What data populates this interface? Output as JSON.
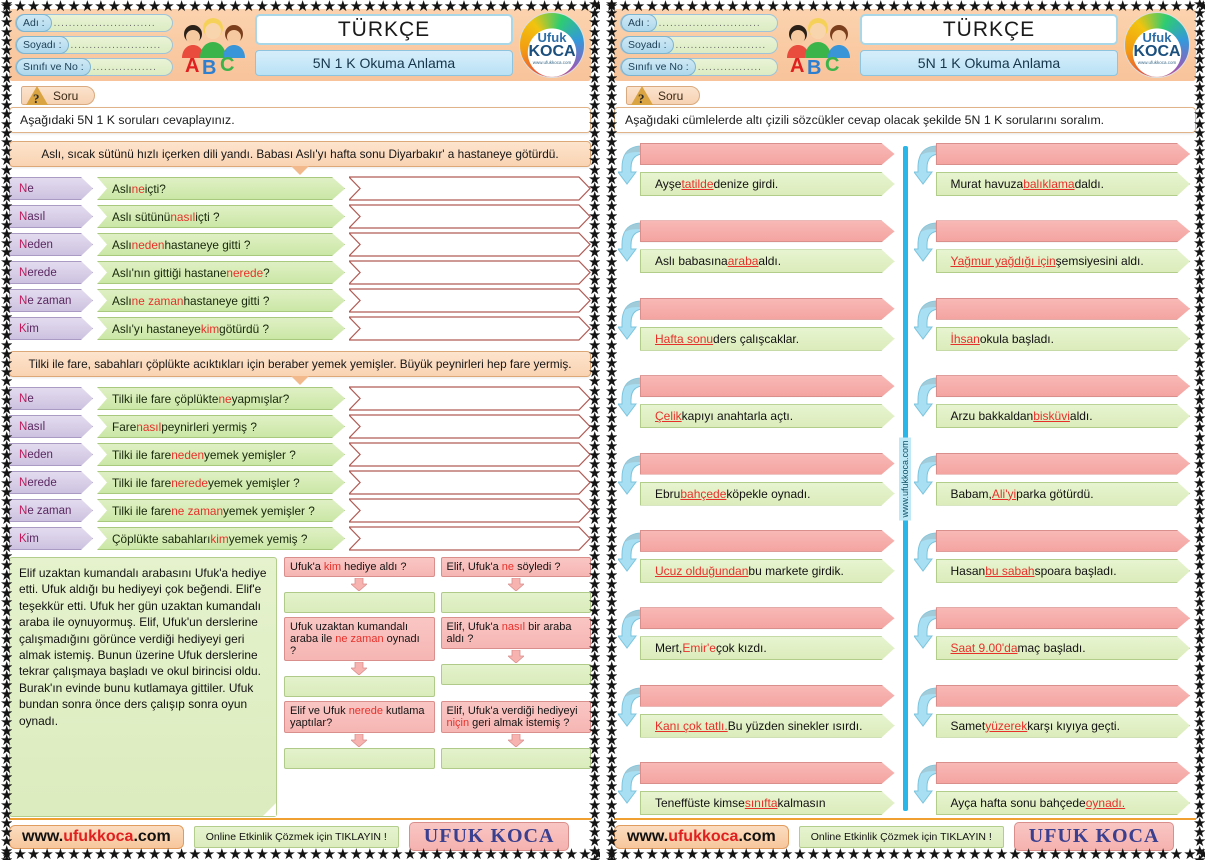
{
  "meta": {
    "star_char": "★"
  },
  "header": {
    "id_fields": [
      {
        "label": "Adı :",
        "value": ""
      },
      {
        "label": "Soyadı :",
        "value": ""
      },
      {
        "label": "Sınıfı ve No :",
        "value": ""
      }
    ],
    "title": "TÜRKÇE",
    "subtitle": "5N 1 K Okuma Anlama",
    "logo": {
      "line1": "Ufuk",
      "line2": "KOCA",
      "line3": "www.ufukkoca.com"
    },
    "kids_icon": "abc-kids-icon"
  },
  "left_page": {
    "soru": {
      "tab_label": "Soru",
      "instruction": "Aşağıdaki 5N 1 K soruları cevaplayınız."
    },
    "blocks": [
      {
        "passage": "Aslı, sıcak sütünü hızlı içerken dili yandı. Babası Aslı'yı hafta sonu Diyarbakır' a hastaneye götürdü.",
        "rows": [
          {
            "tag": "Ne",
            "pre": "Aslı ",
            "hl": "ne",
            "post": " içti?"
          },
          {
            "tag": "Nasıl",
            "pre": "Aslı sütünü ",
            "hl": "nasıl",
            "post": " içti ?"
          },
          {
            "tag": "Neden",
            "pre": "Aslı ",
            "hl": "neden",
            "post": " hastaneye gitti ?"
          },
          {
            "tag": "Nerede",
            "pre": "Aslı'nın gittiği hastane ",
            "hl": "nerede",
            "post": " ?"
          },
          {
            "tag": "Ne zaman",
            "pre": "Aslı ",
            "hl": "ne zaman",
            "post": "  hastaneye gitti ?"
          },
          {
            "tag": "Kim",
            "pre": "Aslı'yı hastaneye ",
            "hl": "kim",
            "post": " götürdü ?"
          }
        ]
      },
      {
        "passage": "Tilki ile fare, sabahları çöplükte acıktıkları için beraber yemek yemişler. Büyük peynirleri hep fare yermiş.",
        "rows": [
          {
            "tag": "Ne",
            "pre": "Tilki ile fare çöplükte ",
            "hl": "ne",
            "post": " yapmışlar?"
          },
          {
            "tag": "Nasıl",
            "pre": "Fare ",
            "hl": "nasıl",
            "post": " peynirleri yermiş ?"
          },
          {
            "tag": "Neden",
            "pre": "Tilki ile fare ",
            "hl": "neden",
            "post": " yemek yemişler ?"
          },
          {
            "tag": "Nerede",
            "pre": "Tilki ile fare ",
            "hl": "nerede",
            "post": " yemek yemişler ?"
          },
          {
            "tag": "Ne zaman",
            "pre": "Tilki ile fare ",
            "hl": "ne zaman",
            "post": "  yemek yemişler ?"
          },
          {
            "tag": "Kim",
            "pre": "Çöplükte sabahları ",
            "hl": "kim",
            "post": " yemek yemiş ?"
          }
        ]
      }
    ],
    "story": "Elif uzaktan kumandalı arabasını Ufuk'a hediye etti. Ufuk aldığı bu hediyeyi çok beğendi. Elif'e teşekkür etti. Ufuk her gün uzaktan kumandalı araba ile oynuyormuş. Elif, Ufuk'un derslerine çalışmadığını görünce verdiği hediyeyi geri almak istemiş. Bunun üzerine Ufuk derslerine tekrar çalışmaya başladı ve okul birincisi oldu. Burak'ın evinde bunu kutlamaya gittiler. Ufuk bundan sonra önce ders çalışıp sonra oyun oynadı.",
    "story_questions": [
      {
        "pre": "Ufuk'a ",
        "hl": "kim",
        "post": " hediye aldı ?"
      },
      {
        "pre": "Elif, Ufuk'a ",
        "hl": "ne",
        "post": " söyledi ?"
      },
      {
        "pre": "Ufuk uzaktan kumandalı araba ile ",
        "hl": "ne zaman",
        "post": " oynadı ?"
      },
      {
        "pre": "Elif, Ufuk'a  ",
        "hl": "nasıl",
        "post": " bir araba aldı ?"
      },
      {
        "pre": "Elif ve Ufuk ",
        "hl": "nerede",
        "post": " kutlama yaptılar?"
      },
      {
        "pre": "Elif, Ufuk'a verdiği hediyeyi ",
        "hl": "niçin",
        "post": " geri almak istemiş ?"
      }
    ]
  },
  "right_page": {
    "soru": {
      "tab_label": "Soru",
      "instruction": "Aşağıdaki cümlelerde altı çizili sözcükler cevap olacak şekilde 5N 1 K sorularını soralım."
    },
    "divider_watermark": "www.ufukkoca.com",
    "left_column": [
      {
        "pre": "Ayşe ",
        "u": "tatilde",
        "post": " denize girdi."
      },
      {
        "pre": "Aslı babasına ",
        "u": "araba",
        "post": " aldı."
      },
      {
        "pre": "",
        "u": "Hafta sonu",
        "post": " ders çalışcaklar."
      },
      {
        "pre": "",
        "u": "Çelik",
        "post": " kapıyı anahtarla açtı."
      },
      {
        "pre": "Ebru ",
        "u": "bahçede",
        "post": " köpekle oynadı."
      },
      {
        "pre": "",
        "u": "Ucuz olduğundan",
        "post": " bu markete girdik."
      },
      {
        "pre": "Mert, ",
        "u": "Emir'e",
        "post": " çok kızdı.",
        "u_plain": true
      },
      {
        "pre": "",
        "u": "Kanı çok tatlı.",
        "post": " Bu yüzden sinekler ısırdı."
      },
      {
        "pre": "Teneffüste kimse ",
        "u": "sınıfta",
        "post": " kalmasın"
      }
    ],
    "right_column": [
      {
        "pre": "Murat havuza ",
        "u": "balıklama ",
        "post": "daldı."
      },
      {
        "pre": "",
        "u": "Yağmur yağdığı için ",
        "post": "şemsiyesini aldı."
      },
      {
        "pre": "",
        "u": "İhsan ",
        "post": "okula başladı."
      },
      {
        "pre": "Arzu bakkaldan ",
        "u": "bisküvi ",
        "post": "aldı."
      },
      {
        "pre": "Babam, ",
        "u": "Ali'yi",
        "post": " parka götürdü."
      },
      {
        "pre": "Hasan ",
        "u": "bu sabah",
        "post": " spoara başladı."
      },
      {
        "pre": "",
        "u": "Saat 9.00'da",
        "post": " maç başladı."
      },
      {
        "pre": "Samet ",
        "u": "yüzerek",
        "post": " karşı kıyıya geçti."
      },
      {
        "pre": "Ayça hafta sonu bahçede ",
        "u": "oynadı.",
        "post": ""
      }
    ]
  },
  "footer": {
    "site_prefix": "www.",
    "site_mid": "ufukkoca",
    "site_suffix": ".com",
    "link_text": "Online Etkinlik Çözmek için TIKLAYIN !",
    "brand": "UFUK KOCA"
  }
}
